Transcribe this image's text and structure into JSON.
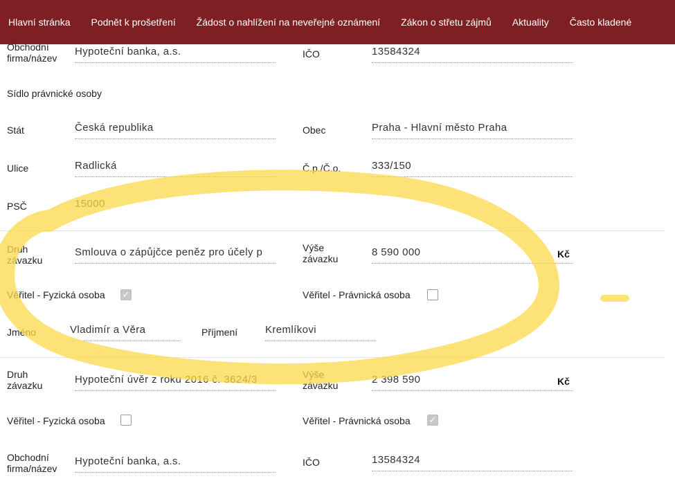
{
  "nav": {
    "items": [
      "Hlavní stránka",
      "Podnět k prošetření",
      "Žádost o nahlížení na neveřejné oznámení",
      "Zákon o střetu zájmů",
      "Aktuality",
      "Často kladené"
    ]
  },
  "block1": {
    "firm_label": "Obchodní firma/název",
    "firm_value": "Hypoteční banka, a.s.",
    "ico_label": "IČO",
    "ico_value": "13584324",
    "seat_heading": "Sídlo právnické osoby",
    "state_label": "Stát",
    "state_value": "Česká republika",
    "city_label": "Obec",
    "city_value": "Praha - Hlavní město Praha",
    "street_label": "Ulice",
    "street_value": "Radlická",
    "num_label": "Č.p./Č.o.",
    "num_value": "333/150",
    "zip_label": "PSČ",
    "zip_value": "15000"
  },
  "block2": {
    "type_label": "Druh závazku",
    "type_value": "Smlouva o zápůjčce peněz pro účely p",
    "amount_label": "Výše závazku",
    "amount_value": "8 590 000",
    "currency": "Kč",
    "person_label": "Věřitel - Fyzická osoba",
    "person_checked": true,
    "company_label": "Věřitel - Právnická osoba",
    "company_checked": false,
    "name_label": "Jméno",
    "name_value": "Vladimír a Věra",
    "surname_label": "Příjmení",
    "surname_value": "Kremlíkovi"
  },
  "block3": {
    "type_label": "Druh závazku",
    "type_value": "Hypoteční úvěr z roku 2016 č. 3624/3",
    "amount_label": "Výše závazku",
    "amount_value": "2 398 590",
    "currency": "Kč",
    "person_label": "Věřitel - Fyzická osoba",
    "person_checked": false,
    "company_label": "Věřitel - Právnická osoba",
    "company_checked": true,
    "firm_label": "Obchodní firma/název",
    "firm_value": "Hypoteční banka, a.s.",
    "ico_label": "IČO",
    "ico_value": "13584324"
  },
  "colors": {
    "nav_bg": "#7e1f23",
    "highlight": "#fcd94a"
  }
}
